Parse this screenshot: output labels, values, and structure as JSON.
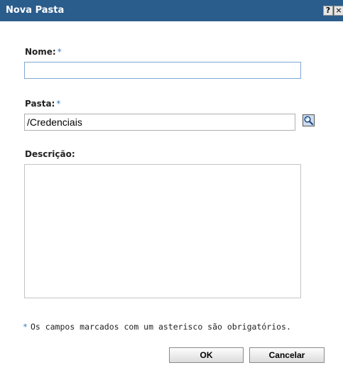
{
  "window": {
    "title": "Nova Pasta",
    "help_label": "?",
    "close_label": "×"
  },
  "form": {
    "nome": {
      "label": "Nome:",
      "required_mark": "*",
      "value": ""
    },
    "pasta": {
      "label": "Pasta:",
      "required_mark": "*",
      "value": "/Credenciais",
      "browse_icon": "magnifier-icon"
    },
    "descricao": {
      "label": "Descrição:",
      "value": ""
    }
  },
  "note": {
    "asterisk": "*",
    "text": "Os campos marcados com um asterisco são obrigatórios."
  },
  "buttons": {
    "ok_label": "OK",
    "cancel_label": "Cancelar"
  },
  "colors": {
    "titlebar": "#2b5d8c",
    "required": "#3a7bbf",
    "focus_border": "#7fa7d6"
  }
}
